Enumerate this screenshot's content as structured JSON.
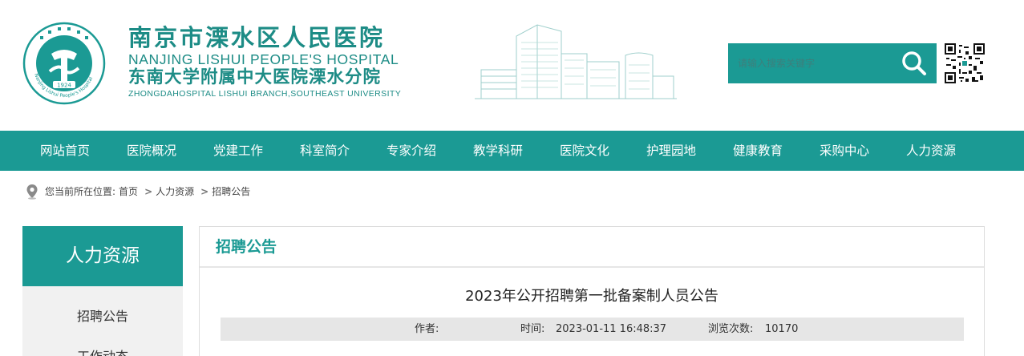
{
  "header": {
    "logo_ring_text": "Nanjing Lishui People's Hospital",
    "logo_year": "1924",
    "name_cn": "南京市溧水区人民医院",
    "name_en": "NANJING LISHUI PEOPLE'S HOSPITAL",
    "branch_cn": "东南大学附属中大医院溧水分院",
    "branch_en": "ZHONGDAHOSPITAL LISHUI BRANCH,SOUTHEAST UNIVERSITY"
  },
  "search": {
    "placeholder": "请输入搜索关键字",
    "icon": "search-icon"
  },
  "nav": {
    "items": [
      "网站首页",
      "医院概况",
      "党建工作",
      "科室简介",
      "专家介绍",
      "教学科研",
      "医院文化",
      "护理园地",
      "健康教育",
      "采购中心",
      "人力资源"
    ]
  },
  "breadcrumb": {
    "prefix": "您当前所在位置:",
    "items": [
      "首页",
      "人力资源",
      "招聘公告"
    ],
    "separator": ">"
  },
  "sidebar": {
    "title": "人力资源",
    "items": [
      "招聘公告",
      "工作动态"
    ]
  },
  "content": {
    "section_title": "招聘公告",
    "article_title": "2023年公开招聘第一批备案制人员公告",
    "meta": {
      "author_label": "作者:",
      "author": "",
      "time_label": "时间:",
      "time": "2023-01-11 16:48:37",
      "views_label": "浏览次数:",
      "views": "10170"
    }
  },
  "colors": {
    "brand_teal": "#1b9a94",
    "meta_bar": "#e6e6e6",
    "sidebar_bg": "#f1f1f1"
  }
}
